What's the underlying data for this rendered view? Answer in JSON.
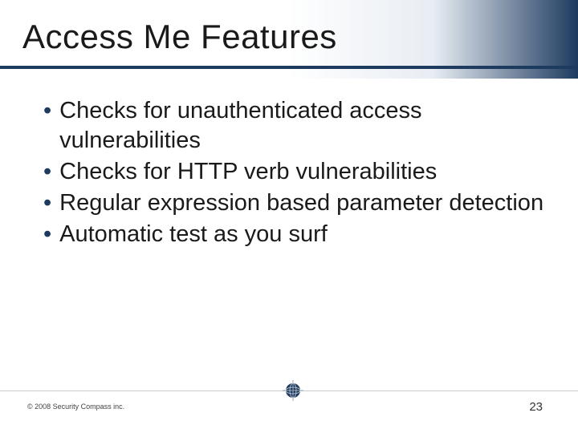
{
  "title": "Access Me Features",
  "bullets": [
    "Checks for unauthenticated access vulnerabilities",
    "Checks for HTTP verb vulnerabilities",
    "Regular expression based parameter detection",
    "Automatic test as you surf"
  ],
  "copyright": "© 2008 Security Compass inc.",
  "page_number": "23"
}
